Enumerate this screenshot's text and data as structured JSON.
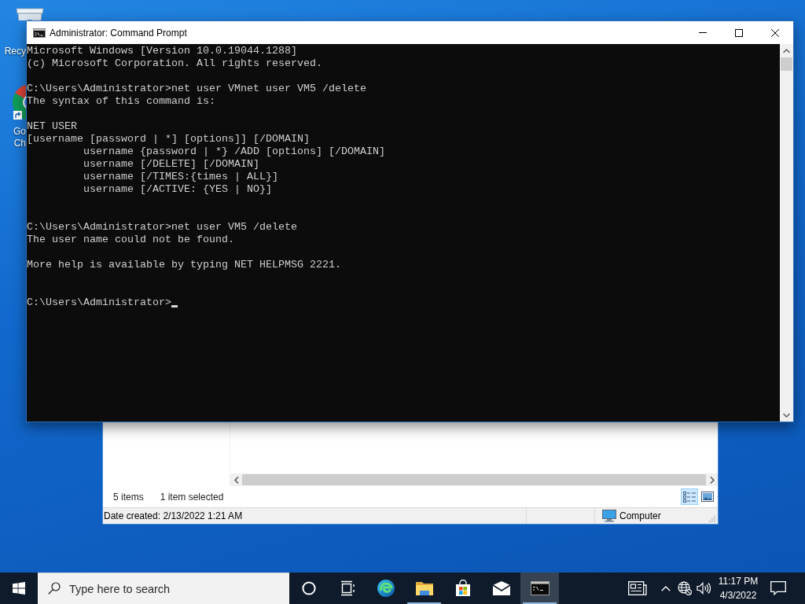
{
  "desktop": {
    "icons": [
      {
        "kind": "bin",
        "shortcut": false,
        "label": "Recy"
      },
      {
        "kind": "browser",
        "shortcut": true,
        "label": "Go\nCh"
      }
    ]
  },
  "console_window": {
    "title": "Administrator: Command Prompt",
    "output": "Microsoft Windows [Version 10.0.19044.1288]\n(c) Microsoft Corporation. All rights reserved.\n\nC:\\Users\\Administrator>net user VMnet user VM5 /delete\nThe syntax of this command is:\n\nNET USER\n[username [password | *] [options]] [/DOMAIN]\n         username {password | *} /ADD [options] [/DOMAIN]\n         username [/DELETE] [/DOMAIN]\n         username [/TIMES:{times | ALL}]\n         username [/ACTIVE: {YES | NO}]\n\n\nC:\\Users\\Administrator>net user VM5 /delete\nThe user name could not be found.\n\nMore help is available by typing NET HELPMSG 2221.\n\n\nC:\\Users\\Administrator>"
  },
  "explorer_window": {
    "status": [
      "5 items",
      "1 item selected"
    ],
    "view_buttons": [
      {
        "kind": "details",
        "selected": true
      },
      {
        "kind": "large_icons",
        "selected": false
      }
    ],
    "details": "Date created: 2/13/2022 1:21 AM",
    "location": "Computer"
  },
  "taskbar": {
    "search": {
      "placeholder": "Type here to search"
    },
    "buttons": [
      {
        "kind": "circle",
        "running": false,
        "active": false
      },
      {
        "kind": "task_view",
        "running": false,
        "active": false
      },
      {
        "kind": "browser",
        "running": false,
        "active": false
      },
      {
        "kind": "files",
        "running": true,
        "active": false
      },
      {
        "kind": "store",
        "running": false,
        "active": false
      },
      {
        "kind": "mail",
        "running": false,
        "active": false
      },
      {
        "kind": "terminal",
        "running": true,
        "active": true
      }
    ],
    "tray": {
      "time": "11:17 PM",
      "date": "4/3/2022"
    }
  }
}
